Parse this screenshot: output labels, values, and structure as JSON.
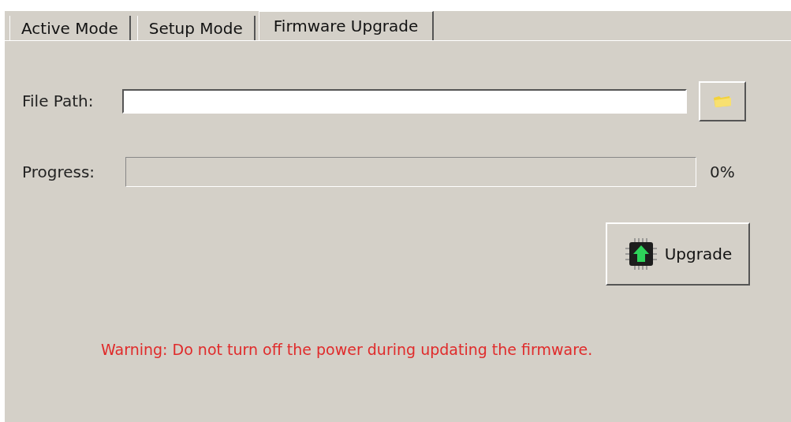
{
  "tabs": [
    {
      "label": "Active Mode",
      "selected": false
    },
    {
      "label": "Setup Mode",
      "selected": false
    },
    {
      "label": "Firmware Upgrade",
      "selected": true
    }
  ],
  "file_path": {
    "label": "File Path:"
  },
  "progress": {
    "label": "Progress:",
    "level": 0,
    "reading": "0%"
  },
  "upgrade_button": {
    "label": "Upgrade"
  },
  "warning": "Warning: Do not turn off the power during updating the firmware."
}
